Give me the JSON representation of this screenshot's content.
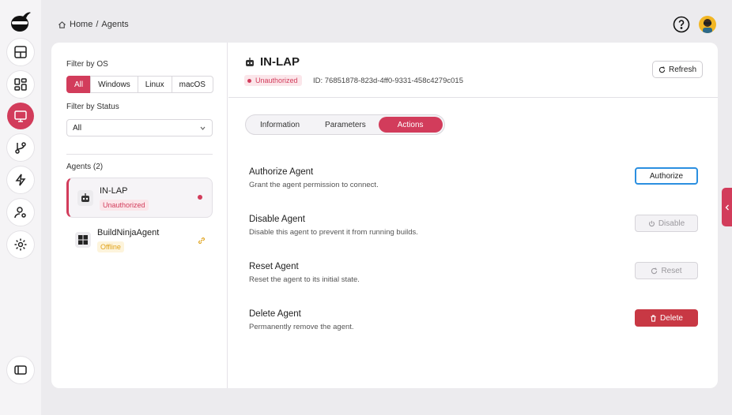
{
  "breadcrumb": {
    "home": "Home",
    "separator": "/",
    "current": "Agents"
  },
  "filters": {
    "os_label": "Filter by OS",
    "os_options": [
      "All",
      "Windows",
      "Linux",
      "macOS"
    ],
    "os_selected": "All",
    "status_label": "Filter by Status",
    "status_value": "All"
  },
  "agents": {
    "heading": "Agents (2)",
    "items": [
      {
        "name": "IN-LAP",
        "status": "Unauthorized",
        "os": "linux"
      },
      {
        "name": "BuildNinjaAgent",
        "status": "Offline",
        "os": "windows"
      }
    ]
  },
  "detail": {
    "name": "IN-LAP",
    "status": "Unauthorized",
    "id_text": "ID: 76851878-823d-4ff0-9331-458c4279c015",
    "refresh_label": "Refresh",
    "tabs": [
      "Information",
      "Parameters",
      "Actions"
    ],
    "active_tab": "Actions",
    "actions": [
      {
        "title": "Authorize Agent",
        "desc": "Grant the agent permission to connect.",
        "button": "Authorize"
      },
      {
        "title": "Disable Agent",
        "desc": "Disable this agent to prevent it from running builds.",
        "button": "Disable"
      },
      {
        "title": "Reset Agent",
        "desc": "Reset the agent to its initial state.",
        "button": "Reset"
      },
      {
        "title": "Delete Agent",
        "desc": "Permanently remove the agent.",
        "button": "Delete"
      }
    ]
  },
  "colors": {
    "accent": "#d23c5b",
    "focus": "#2b8fe0",
    "danger": "#c83844",
    "offline": "#e0a21a"
  },
  "icons": [
    "ninja-logo-icon",
    "dashboard-icon",
    "grid-icon",
    "monitor-icon",
    "git-branch-icon",
    "lightning-icon",
    "user-gear-icon",
    "settings-icon",
    "sidebar-toggle-icon",
    "home-icon",
    "help-icon",
    "robot-icon",
    "windows-icon",
    "unlink-icon",
    "refresh-icon",
    "power-icon",
    "trash-icon",
    "chevron-left-icon"
  ]
}
